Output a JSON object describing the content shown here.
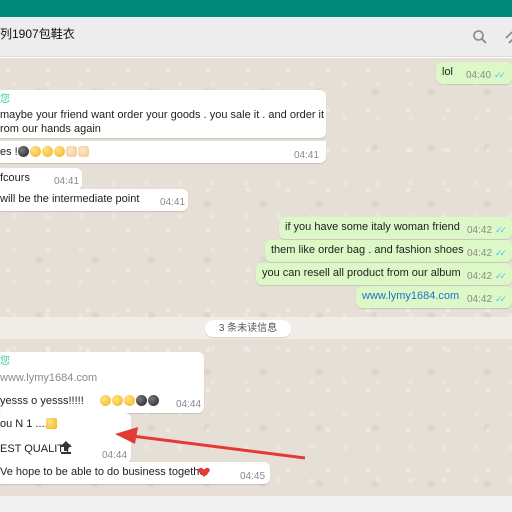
{
  "topbar_color": "#00897b",
  "header": {
    "title": "列1907包鞋衣",
    "icons": [
      "search-icon",
      "attach-icon"
    ]
  },
  "messages": [
    {
      "dir": "out",
      "text": "lol",
      "time": "04:40",
      "ticks": "✓✓"
    },
    {
      "dir": "in",
      "sender": "您",
      "text": "maybe your friend want order your goods . you sale it . and order it",
      "text2": "rom our hands again",
      "time": "04:41"
    },
    {
      "dir": "in",
      "text": "es !!!",
      "time": ""
    },
    {
      "dir": "in",
      "text": "fcours",
      "time": "04:41"
    },
    {
      "dir": "in",
      "text": "will be the intermediate point",
      "time": "04:41"
    },
    {
      "dir": "out",
      "text": "if you have some italy woman friend",
      "time": "04:42",
      "ticks": "✓✓"
    },
    {
      "dir": "out",
      "text": "them like order bag . and fashion shoes",
      "time": "04:42",
      "ticks": "✓✓"
    },
    {
      "dir": "out",
      "text": "you can resell all product from our album",
      "time": "04:42",
      "ticks": "✓✓"
    },
    {
      "dir": "out",
      "text": "www.lymy1684.com",
      "time": "04:42",
      "ticks": "✓✓"
    },
    {
      "dir": "in",
      "sender": "您",
      "text": "www.lymy1684.com",
      "text2": "yesss o yesss!!!!!",
      "time": "04:44"
    },
    {
      "dir": "in",
      "text": "ou N 1 ....",
      "text2": "EST QUALITY",
      "time": "04:44"
    },
    {
      "dir": "in",
      "text": "Ve hope to be able to do business together",
      "time": "04:45"
    }
  ],
  "unread_divider": "3 条未读信息",
  "accent": {
    "outgoing_bubble": "#dcf8c6",
    "incoming_bubble": "#ffffff",
    "arrow": "#e53935",
    "tick": "#4fc3f7"
  },
  "icons": {
    "search": "search-icon",
    "attach": "attach-icon",
    "crown": "crown-icon",
    "top": "top-icon",
    "heart": "heart-icon",
    "arrow": "annotation-arrow"
  }
}
